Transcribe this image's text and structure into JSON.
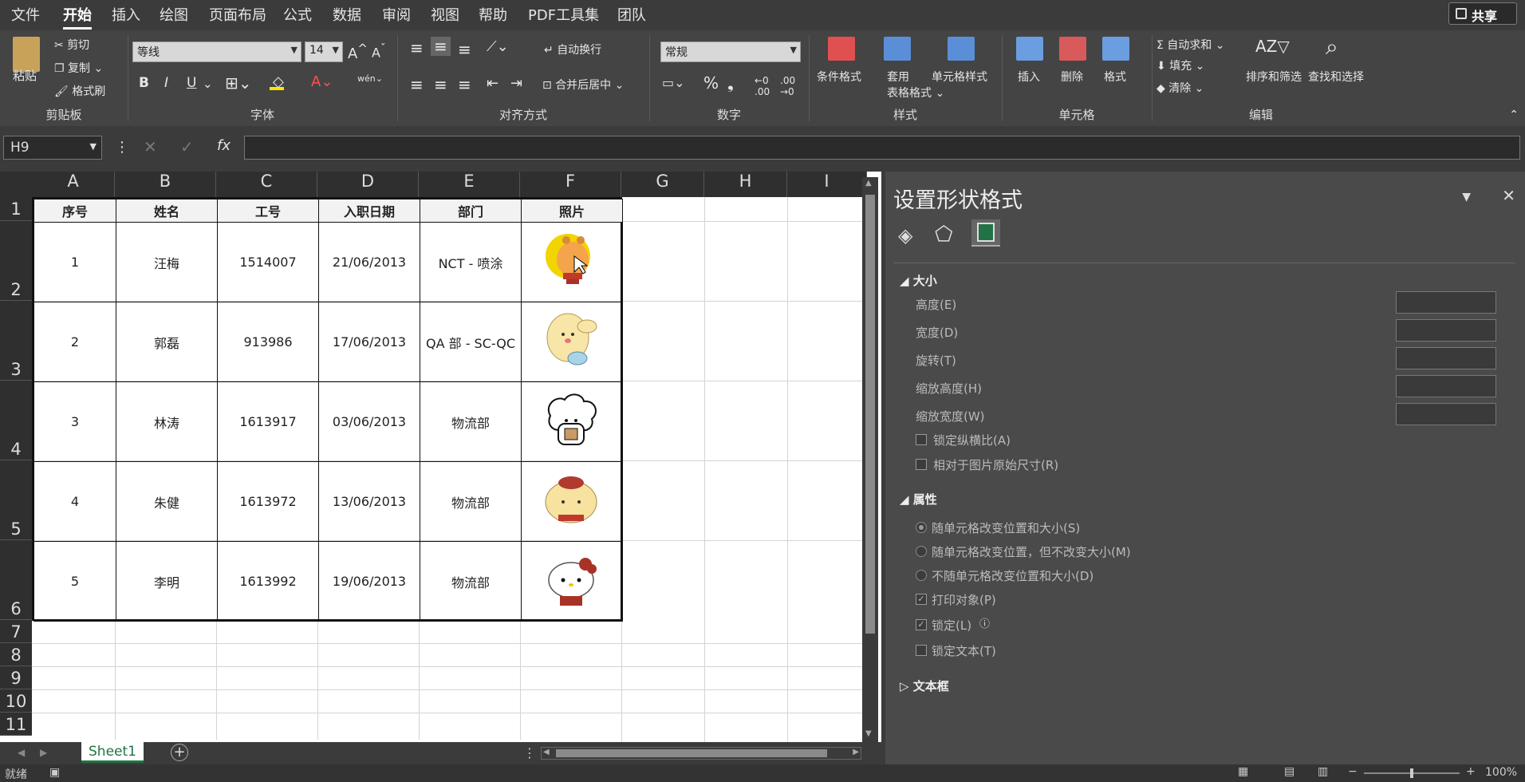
{
  "menu": {
    "items": [
      "文件",
      "开始",
      "插入",
      "绘图",
      "页面布局",
      "公式",
      "数据",
      "审阅",
      "视图",
      "帮助",
      "PDF工具集",
      "团队"
    ],
    "active": "开始",
    "share_label": "共享"
  },
  "ribbon": {
    "clipboard": {
      "paste": "粘贴",
      "cut": "剪切",
      "copy": "复制",
      "format_painter": "格式刷",
      "group": "剪贴板"
    },
    "font": {
      "name": "等线",
      "size": "14",
      "bold": "B",
      "italic": "I",
      "underline": "U",
      "phonetic": "wén",
      "group": "字体"
    },
    "alignment": {
      "wrap": "自动换行",
      "merge": "合并后居中",
      "group": "对齐方式"
    },
    "number": {
      "format": "常规",
      "group": "数字"
    },
    "styles": {
      "conditional": "条件格式",
      "table_fmt_1": "套用",
      "table_fmt_2": "表格格式",
      "cell_styles": "单元格样式",
      "group": "样式"
    },
    "cells": {
      "insert": "插入",
      "delete": "删除",
      "format": "格式",
      "group": "单元格"
    },
    "editing": {
      "autosum": "自动求和",
      "fill": "填充",
      "clear": "清除",
      "sort": "排序和筛选",
      "find": "查找和选择",
      "group": "编辑"
    }
  },
  "formula_bar": {
    "name_box": "H9",
    "fx": "fx",
    "value": ""
  },
  "sheet": {
    "columns": [
      "A",
      "B",
      "C",
      "D",
      "E",
      "F",
      "G",
      "H",
      "I"
    ],
    "rows": [
      "1",
      "2",
      "3",
      "4",
      "5",
      "6",
      "7",
      "8",
      "9",
      "10",
      "11"
    ],
    "header": [
      "序号",
      "姓名",
      "工号",
      "入职日期",
      "部门",
      "照片"
    ],
    "data": [
      [
        "1",
        "汪梅",
        "1514007",
        "21/06/2013",
        "NCT - 喷涂"
      ],
      [
        "2",
        "郭磊",
        "913986",
        "17/06/2013",
        "QA 部 - SC-QC"
      ],
      [
        "3",
        "林涛",
        "1613917",
        "03/06/2013",
        "物流部"
      ],
      [
        "4",
        "朱健",
        "1613972",
        "13/06/2013",
        "物流部"
      ],
      [
        "5",
        "李明",
        "1613992",
        "19/06/2013",
        "物流部"
      ]
    ],
    "tab": "Sheet1"
  },
  "pane": {
    "title": "设置形状格式",
    "size_section": "大小",
    "height": "高度(E)",
    "width": "宽度(D)",
    "rotation": "旋转(T)",
    "scale_height": "缩放高度(H)",
    "scale_width": "缩放宽度(W)",
    "lock_aspect": "锁定纵横比(A)",
    "relative_original": "相对于图片原始尺寸(R)",
    "props_section": "属性",
    "move_size": "随单元格改变位置和大小(S)",
    "move_only": "随单元格改变位置，但不改变大小(M)",
    "no_move": "不随单元格改变位置和大小(D)",
    "print_obj": "打印对象(P)",
    "locked": "锁定(L)",
    "lock_text": "锁定文本(T)",
    "textbox_section": "文本框"
  },
  "status": {
    "ready": "就绪",
    "zoom": "100%"
  },
  "colors": {
    "accent_green": "#217346",
    "dark_bg": "#3b3b3b"
  }
}
